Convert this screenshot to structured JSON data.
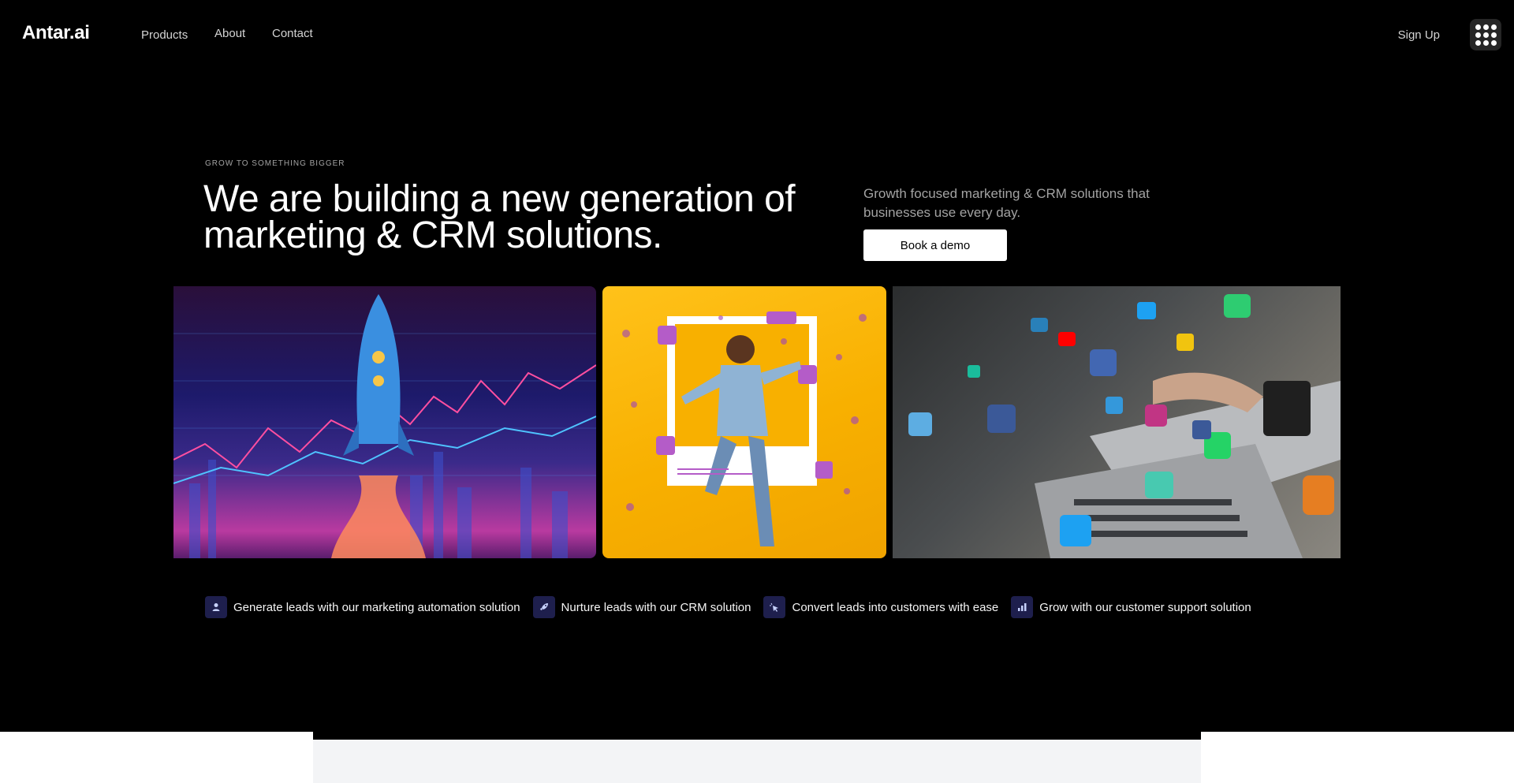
{
  "nav": {
    "logo": "Antar.ai",
    "links": [
      "Products",
      "About",
      "Contact"
    ],
    "signup": "Sign Up",
    "apps_icon": "grid-menu-icon"
  },
  "hero": {
    "eyebrow": "GROW TO SOMETHING BIGGER",
    "headline": "We are building a new generation of marketing & CRM solutions.",
    "subtext": "Growth focused marketing & CRM solutions that businesses use every day.",
    "cta": "Book a demo"
  },
  "images": [
    {
      "name": "rocket-growth-chart-image"
    },
    {
      "name": "social-media-influencer-image"
    },
    {
      "name": "laptop-social-icons-image"
    }
  ],
  "features": [
    {
      "icon": "user-icon",
      "label": "Generate leads with our marketing automation solution"
    },
    {
      "icon": "rocket-icon",
      "label": "Nurture leads with our CRM solution"
    },
    {
      "icon": "cursor-click-icon",
      "label": "Convert leads into customers with ease"
    },
    {
      "icon": "bar-chart-icon",
      "label": "Grow with our customer support solution"
    }
  ],
  "colors": {
    "background": "#000000",
    "accent_icon_bg": "#1e1f4d",
    "button_bg": "#ffffff"
  }
}
